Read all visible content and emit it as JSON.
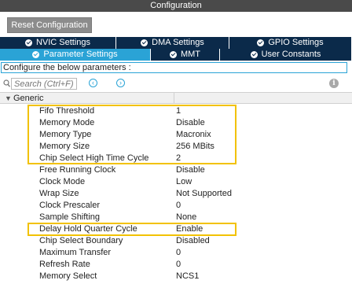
{
  "window": {
    "title": "Configuration"
  },
  "toolbar": {
    "reset_label": "Reset Configuration"
  },
  "tabs_row1": [
    {
      "label": "NVIC Settings",
      "checked": true,
      "active": false
    },
    {
      "label": "DMA Settings",
      "checked": true,
      "active": false
    },
    {
      "label": "GPIO Settings",
      "checked": true,
      "active": false
    }
  ],
  "tabs_row2": [
    {
      "label": "Parameter Settings",
      "checked": true,
      "active": true
    },
    {
      "label": "MMT",
      "checked": true,
      "active": false
    },
    {
      "label": "User Constants",
      "checked": true,
      "active": false
    }
  ],
  "configure_text": "Configure the below parameters :",
  "search": {
    "placeholder": "Search (Ctrl+F)"
  },
  "group": {
    "label": "Generic"
  },
  "properties": [
    {
      "name": "Fifo Threshold",
      "value": "1"
    },
    {
      "name": "Memory Mode",
      "value": "Disable"
    },
    {
      "name": "Memory Type",
      "value": "Macronix"
    },
    {
      "name": "Memory Size",
      "value": "256 MBits"
    },
    {
      "name": "Chip Select High Time Cycle",
      "value": "2"
    },
    {
      "name": "Free Running Clock",
      "value": "Disable"
    },
    {
      "name": "Clock Mode",
      "value": "Low"
    },
    {
      "name": "Wrap Size",
      "value": "Not Supported"
    },
    {
      "name": "Clock Prescaler",
      "value": "0"
    },
    {
      "name": "Sample Shifting",
      "value": "None"
    },
    {
      "name": "Delay Hold Quarter Cycle",
      "value": "Enable"
    },
    {
      "name": "Chip Select Boundary",
      "value": "Disabled"
    },
    {
      "name": "Maximum Transfer",
      "value": "0"
    },
    {
      "name": "Refresh Rate",
      "value": "0"
    },
    {
      "name": "Memory Select",
      "value": "NCS1"
    }
  ],
  "colors": {
    "accent": "#2aa3d6",
    "tab_dark": "#0b2a4a",
    "highlight": "#f2c200"
  }
}
